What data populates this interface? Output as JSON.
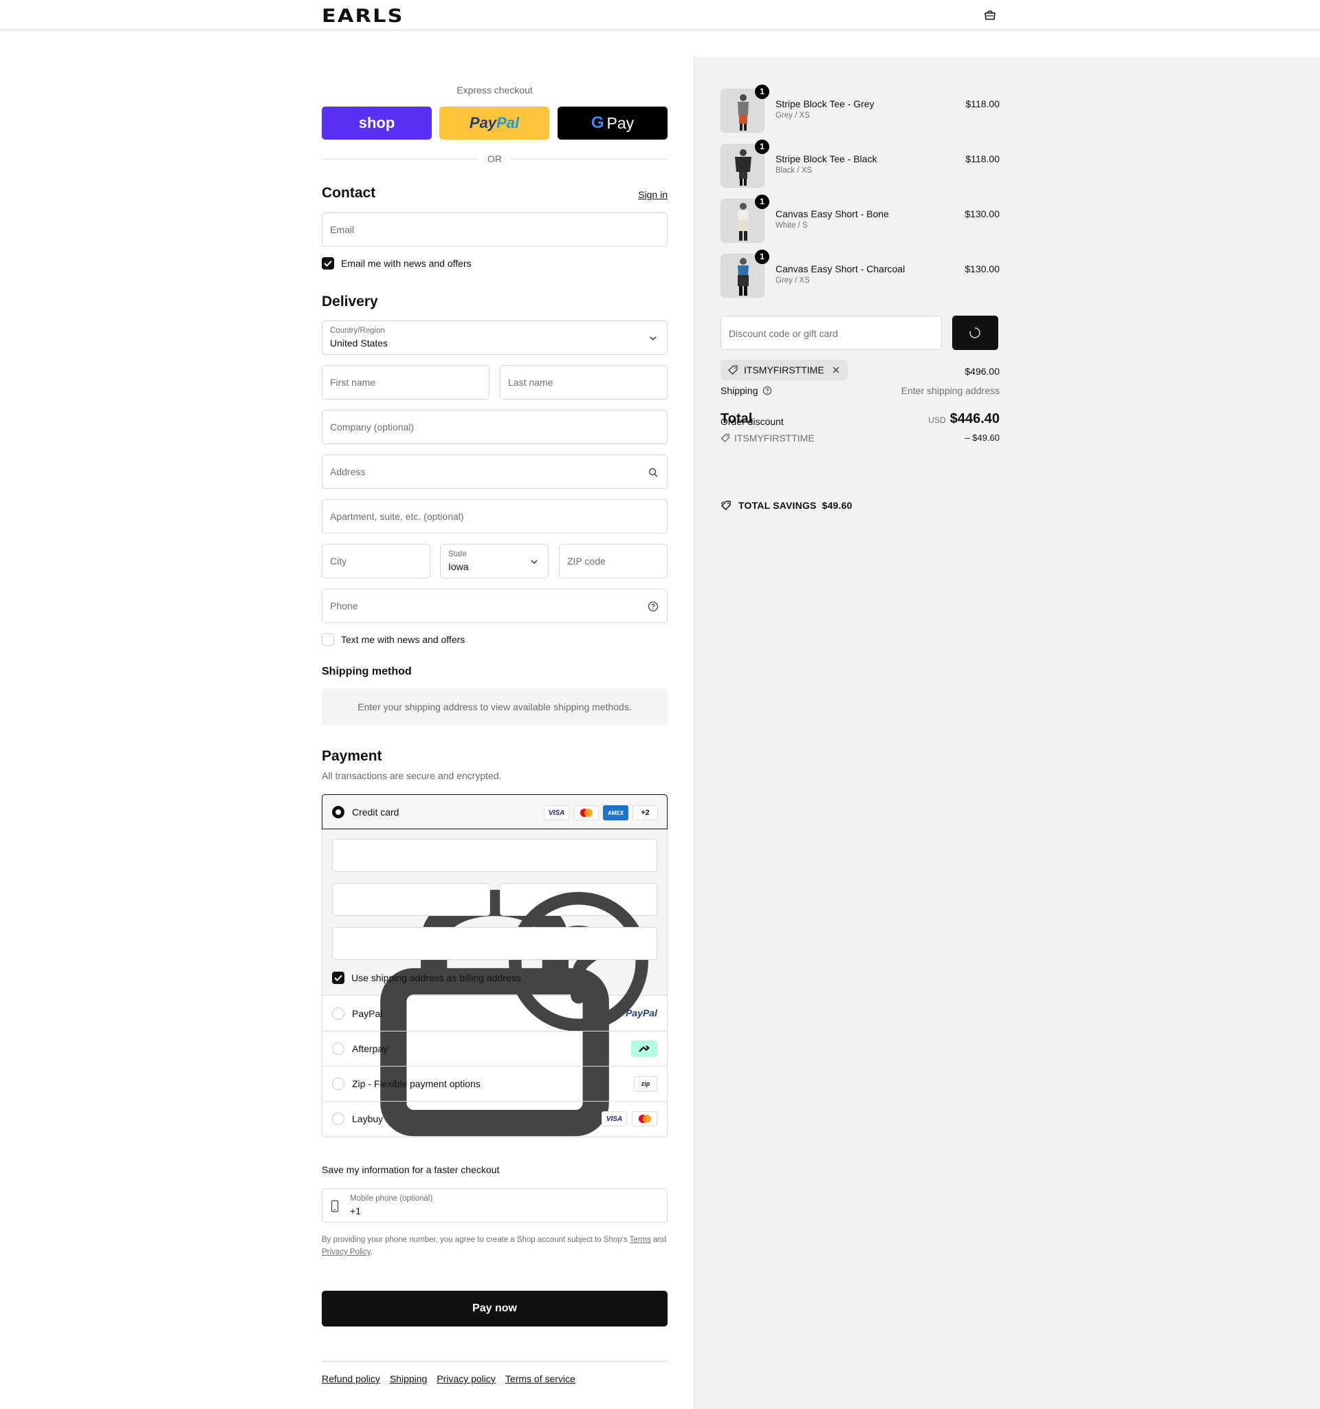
{
  "header": {
    "logo": "EARLS",
    "cart_icon": "bag-icon"
  },
  "express": {
    "label": "Express checkout",
    "shop_label": "shop",
    "paypal_label_1": "Pay",
    "paypal_label_2": "Pal",
    "gpay_g": "G",
    "gpay_label": "Pay",
    "or": "OR"
  },
  "contact": {
    "title": "Contact",
    "sign_in": "Sign in",
    "email_placeholder": "Email",
    "news_label": "Email me with news and offers",
    "news_checked": true
  },
  "delivery": {
    "title": "Delivery",
    "country_label": "Country/Region",
    "country_value": "United States",
    "first_name": "First name",
    "last_name": "Last name",
    "company": "Company (optional)",
    "address": "Address",
    "apartment": "Apartment, suite, etc. (optional)",
    "city": "City",
    "state_label": "State",
    "state_value": "Iowa",
    "zip": "ZIP code",
    "phone": "Phone",
    "sms_label": "Text me with news and offers",
    "sms_checked": false
  },
  "shipping_method": {
    "title": "Shipping method",
    "message": "Enter your shipping address to view available shipping methods."
  },
  "payment": {
    "title": "Payment",
    "subtitle": "All transactions are secure and encrypted.",
    "credit_card_label": "Credit card",
    "card_badges": [
      "VISA",
      "mastercard",
      "AMEX",
      "+2"
    ],
    "billing_label": "Use shipping address as billing address",
    "billing_checked": true,
    "options": [
      {
        "label": "PayPal",
        "logo": "PayPal"
      },
      {
        "label": "Afterpay",
        "logo": "afterpay-icon"
      },
      {
        "label": "Zip - Flexible payment options",
        "logo": "zip"
      },
      {
        "label": "Laybuy",
        "logo": "VISA"
      }
    ]
  },
  "save_info": {
    "title": "Save my information for a faster checkout",
    "mobile_label": "Mobile phone (optional)",
    "mobile_value": "+1",
    "fine_print_1": "By providing your phone number, you agree to create a Shop account subject to Shop's",
    "terms": "Terms",
    "and": "and",
    "privacy": "Privacy Policy",
    "period": "."
  },
  "pay_now": "Pay now",
  "footer_links": [
    "Refund policy",
    "Shipping",
    "Privacy policy",
    "Terms of service"
  ],
  "cart": {
    "items": [
      {
        "name": "Stripe Block Tee - Grey",
        "variant": "Grey / XS",
        "price": "$118.00",
        "qty": "1"
      },
      {
        "name": "Stripe Block Tee - Black",
        "variant": "Black / XS",
        "price": "$118.00",
        "qty": "1"
      },
      {
        "name": "Canvas Easy Short - Bone",
        "variant": "White / S",
        "price": "$130.00",
        "qty": "1"
      },
      {
        "name": "Canvas Easy Short - Charcoal",
        "variant": "Grey / XS",
        "price": "$130.00",
        "qty": "1"
      }
    ],
    "discount_placeholder": "Discount code or gift card",
    "applied_code": "ITSMYFIRSTTIME",
    "subtotal": "$496.00",
    "shipping_label": "Shipping",
    "shipping_value": "Enter shipping address",
    "total_label": "Total",
    "currency": "USD",
    "total_value": "$446.40",
    "order_discount_label": "Order discount",
    "discount_code": "ITSMYFIRSTTIME",
    "discount_value": "– $49.60",
    "savings_label": "TOTAL SAVINGS",
    "savings_value": "$49.60"
  },
  "colors": {
    "shop_purple": "#5a31f4",
    "paypal_yellow": "#ffc439",
    "dark": "#111111",
    "summary_bg": "#f2f2f2",
    "afterpay_mint": "#b2fce4"
  }
}
